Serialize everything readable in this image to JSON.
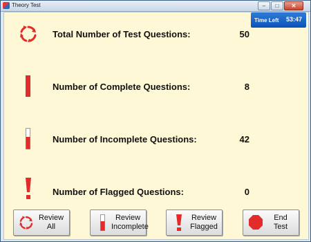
{
  "window": {
    "title": "Theory Test",
    "controls": {
      "minimize": "–",
      "maximize": "□",
      "close": "✕"
    }
  },
  "timer": {
    "label": "Time Left",
    "value": "53:47"
  },
  "stats": [
    {
      "label": "Total Number of Test Questions:",
      "value": "50",
      "icon": "refresh-icon"
    },
    {
      "label": "Number of Complete Questions:",
      "value": "8",
      "icon": "complete-bar-icon"
    },
    {
      "label": "Number of Incomplete Questions:",
      "value": "42",
      "icon": "incomplete-bar-icon"
    },
    {
      "label": "Number of Flagged Questions:",
      "value": "0",
      "icon": "exclamation-icon"
    }
  ],
  "buttons": [
    {
      "line1": "Review",
      "line2": "All",
      "icon": "refresh-icon"
    },
    {
      "line1": "Review",
      "line2": "Incomplete",
      "icon": "incomplete-bar-icon"
    },
    {
      "line1": "Review",
      "line2": "Flagged",
      "icon": "exclamation-icon"
    },
    {
      "line1": "End",
      "line2": "Test",
      "icon": "stop-octagon-icon"
    }
  ],
  "colors": {
    "accent_red": "#e22b2b",
    "background": "#fef8d6",
    "timer_blue": "#0b52b8"
  }
}
